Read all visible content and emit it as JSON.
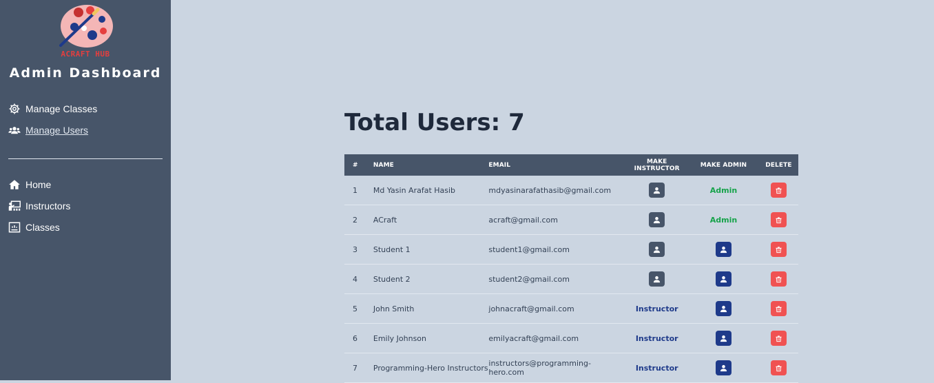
{
  "sidebar": {
    "logo_text": "ACRAFT HUB",
    "title": "Admin Dashboard",
    "admin_links": [
      {
        "label": "Manage Classes",
        "icon": "gear-icon"
      },
      {
        "label": "Manage Users",
        "icon": "users-icon",
        "active": true
      }
    ],
    "main_links": [
      {
        "label": "Home",
        "icon": "home-icon"
      },
      {
        "label": "Instructors",
        "icon": "instructor-icon"
      },
      {
        "label": "Classes",
        "icon": "classes-icon"
      }
    ]
  },
  "main": {
    "title": "Total Users: 7",
    "columns": [
      "#",
      "NAME",
      "EMAIL",
      "MAKE INSTRUCTOR",
      "MAKE ADMIN",
      "DELETE"
    ],
    "rows": [
      {
        "index": "1",
        "name": "Md Yasin Arafat Hasib",
        "email": "mdyasinarafathasib@gmail.com",
        "instructor_status": null,
        "admin_status": "Admin"
      },
      {
        "index": "2",
        "name": "ACraft",
        "email": "acraft@gmail.com",
        "instructor_status": null,
        "admin_status": "Admin"
      },
      {
        "index": "3",
        "name": "Student 1",
        "email": "student1@gmail.com",
        "instructor_status": null,
        "admin_status": null
      },
      {
        "index": "4",
        "name": "Student 2",
        "email": "student2@gmail.com",
        "instructor_status": null,
        "admin_status": null
      },
      {
        "index": "5",
        "name": "John Smith",
        "email": "johnacraft@gmail.com",
        "instructor_status": "Instructor",
        "admin_status": null
      },
      {
        "index": "6",
        "name": "Emily Johnson",
        "email": "emilyacraft@gmail.com",
        "instructor_status": "Instructor",
        "admin_status": null
      },
      {
        "index": "7",
        "name": "Programming-Hero Instructors",
        "email": "instructors@programming-hero.com",
        "instructor_status": "Instructor",
        "admin_status": null
      }
    ]
  },
  "colors": {
    "sidebar_bg": "#475569",
    "page_bg": "#cbd5e1",
    "admin_green": "#16a34a",
    "instructor_blue": "#1e3a8a",
    "delete_red": "#f05252"
  }
}
